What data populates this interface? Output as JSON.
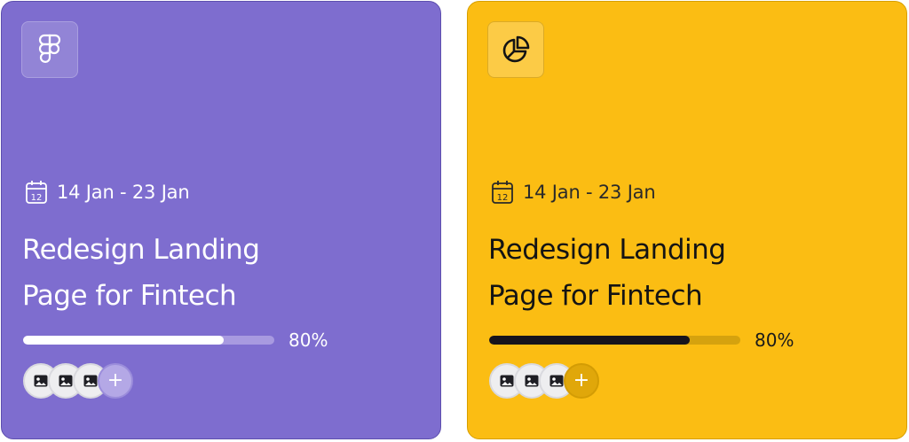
{
  "cards": [
    {
      "icon": "figma-icon",
      "background": "#7e6dcf",
      "date_range": "14 Jan - 23 Jan",
      "title_line1": "Redesign Landing",
      "title_line2": "Page for Fintech",
      "progress": 0.8,
      "progress_label": "80%",
      "avatar_count": 3,
      "add_symbol": "+"
    },
    {
      "icon": "pie-chart-icon",
      "background": "#fbbd13",
      "date_range": "14 Jan - 23 Jan",
      "title_line1": "Redesign Landing",
      "title_line2": "Page for Fintech",
      "progress": 0.8,
      "progress_label": "80%",
      "avatar_count": 3,
      "add_symbol": "+"
    }
  ]
}
